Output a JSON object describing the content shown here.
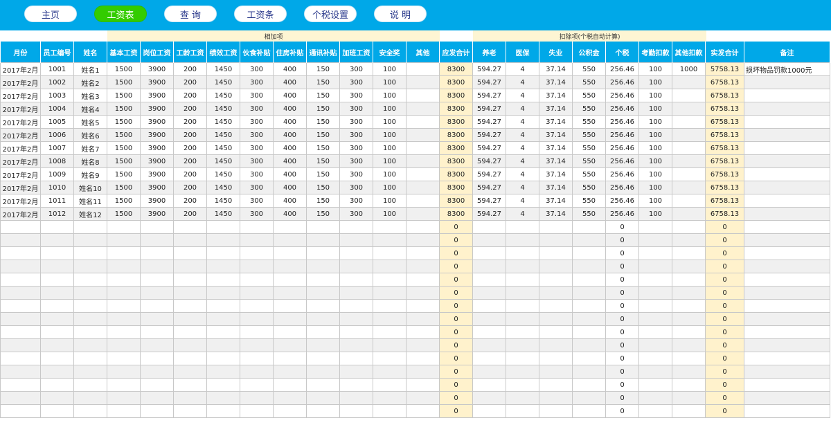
{
  "nav": [
    "主页",
    "工资表",
    "查 询",
    "工资条",
    "个税设置",
    "说 明"
  ],
  "groups": {
    "add": "相加项",
    "deduct": "扣除项(个税自动计算)"
  },
  "columns": [
    "月份",
    "员工编号",
    "姓名",
    "基本工资",
    "岗位工资",
    "工龄工资",
    "绩效工资",
    "伙食补贴",
    "住房补贴",
    "通讯补贴",
    "加班工资",
    "安全奖",
    "其他",
    "应发合计",
    "养老",
    "医保",
    "失业",
    "公积金",
    "个税",
    "考勤扣款",
    "其他扣款",
    "实发合计",
    "备注"
  ],
  "rows": [
    [
      "2017年2月",
      "1001",
      "姓名1",
      "1500",
      "3900",
      "200",
      "1450",
      "300",
      "400",
      "150",
      "300",
      "100",
      "",
      "8300",
      "594.27",
      "4",
      "37.14",
      "550",
      "256.46",
      "100",
      "1000",
      "5758.13",
      "损坏物品罚款1000元"
    ],
    [
      "2017年2月",
      "1002",
      "姓名2",
      "1500",
      "3900",
      "200",
      "1450",
      "300",
      "400",
      "150",
      "300",
      "100",
      "",
      "8300",
      "594.27",
      "4",
      "37.14",
      "550",
      "256.46",
      "100",
      "",
      "6758.13",
      ""
    ],
    [
      "2017年2月",
      "1003",
      "姓名3",
      "1500",
      "3900",
      "200",
      "1450",
      "300",
      "400",
      "150",
      "300",
      "100",
      "",
      "8300",
      "594.27",
      "4",
      "37.14",
      "550",
      "256.46",
      "100",
      "",
      "6758.13",
      ""
    ],
    [
      "2017年2月",
      "1004",
      "姓名4",
      "1500",
      "3900",
      "200",
      "1450",
      "300",
      "400",
      "150",
      "300",
      "100",
      "",
      "8300",
      "594.27",
      "4",
      "37.14",
      "550",
      "256.46",
      "100",
      "",
      "6758.13",
      ""
    ],
    [
      "2017年2月",
      "1005",
      "姓名5",
      "1500",
      "3900",
      "200",
      "1450",
      "300",
      "400",
      "150",
      "300",
      "100",
      "",
      "8300",
      "594.27",
      "4",
      "37.14",
      "550",
      "256.46",
      "100",
      "",
      "6758.13",
      ""
    ],
    [
      "2017年2月",
      "1006",
      "姓名6",
      "1500",
      "3900",
      "200",
      "1450",
      "300",
      "400",
      "150",
      "300",
      "100",
      "",
      "8300",
      "594.27",
      "4",
      "37.14",
      "550",
      "256.46",
      "100",
      "",
      "6758.13",
      ""
    ],
    [
      "2017年2月",
      "1007",
      "姓名7",
      "1500",
      "3900",
      "200",
      "1450",
      "300",
      "400",
      "150",
      "300",
      "100",
      "",
      "8300",
      "594.27",
      "4",
      "37.14",
      "550",
      "256.46",
      "100",
      "",
      "6758.13",
      ""
    ],
    [
      "2017年2月",
      "1008",
      "姓名8",
      "1500",
      "3900",
      "200",
      "1450",
      "300",
      "400",
      "150",
      "300",
      "100",
      "",
      "8300",
      "594.27",
      "4",
      "37.14",
      "550",
      "256.46",
      "100",
      "",
      "6758.13",
      ""
    ],
    [
      "2017年2月",
      "1009",
      "姓名9",
      "1500",
      "3900",
      "200",
      "1450",
      "300",
      "400",
      "150",
      "300",
      "100",
      "",
      "8300",
      "594.27",
      "4",
      "37.14",
      "550",
      "256.46",
      "100",
      "",
      "6758.13",
      ""
    ],
    [
      "2017年2月",
      "1010",
      "姓名10",
      "1500",
      "3900",
      "200",
      "1450",
      "300",
      "400",
      "150",
      "300",
      "100",
      "",
      "8300",
      "594.27",
      "4",
      "37.14",
      "550",
      "256.46",
      "100",
      "",
      "6758.13",
      ""
    ],
    [
      "2017年2月",
      "1011",
      "姓名11",
      "1500",
      "3900",
      "200",
      "1450",
      "300",
      "400",
      "150",
      "300",
      "100",
      "",
      "8300",
      "594.27",
      "4",
      "37.14",
      "550",
      "256.46",
      "100",
      "",
      "6758.13",
      ""
    ],
    [
      "2017年2月",
      "1012",
      "姓名12",
      "1500",
      "3900",
      "200",
      "1450",
      "300",
      "400",
      "150",
      "300",
      "100",
      "",
      "8300",
      "594.27",
      "4",
      "37.14",
      "550",
      "256.46",
      "100",
      "",
      "6758.13",
      ""
    ],
    [
      "",
      "",
      "",
      "",
      "",
      "",
      "",
      "",
      "",
      "",
      "",
      "",
      "",
      "0",
      "",
      "",
      "",
      "",
      "0",
      "",
      "",
      "0",
      ""
    ],
    [
      "",
      "",
      "",
      "",
      "",
      "",
      "",
      "",
      "",
      "",
      "",
      "",
      "",
      "0",
      "",
      "",
      "",
      "",
      "0",
      "",
      "",
      "0",
      ""
    ],
    [
      "",
      "",
      "",
      "",
      "",
      "",
      "",
      "",
      "",
      "",
      "",
      "",
      "",
      "0",
      "",
      "",
      "",
      "",
      "0",
      "",
      "",
      "0",
      ""
    ],
    [
      "",
      "",
      "",
      "",
      "",
      "",
      "",
      "",
      "",
      "",
      "",
      "",
      "",
      "0",
      "",
      "",
      "",
      "",
      "0",
      "",
      "",
      "0",
      ""
    ],
    [
      "",
      "",
      "",
      "",
      "",
      "",
      "",
      "",
      "",
      "",
      "",
      "",
      "",
      "0",
      "",
      "",
      "",
      "",
      "0",
      "",
      "",
      "0",
      ""
    ],
    [
      "",
      "",
      "",
      "",
      "",
      "",
      "",
      "",
      "",
      "",
      "",
      "",
      "",
      "0",
      "",
      "",
      "",
      "",
      "0",
      "",
      "",
      "0",
      ""
    ],
    [
      "",
      "",
      "",
      "",
      "",
      "",
      "",
      "",
      "",
      "",
      "",
      "",
      "",
      "0",
      "",
      "",
      "",
      "",
      "0",
      "",
      "",
      "0",
      ""
    ],
    [
      "",
      "",
      "",
      "",
      "",
      "",
      "",
      "",
      "",
      "",
      "",
      "",
      "",
      "0",
      "",
      "",
      "",
      "",
      "0",
      "",
      "",
      "0",
      ""
    ],
    [
      "",
      "",
      "",
      "",
      "",
      "",
      "",
      "",
      "",
      "",
      "",
      "",
      "",
      "0",
      "",
      "",
      "",
      "",
      "0",
      "",
      "",
      "0",
      ""
    ],
    [
      "",
      "",
      "",
      "",
      "",
      "",
      "",
      "",
      "",
      "",
      "",
      "",
      "",
      "0",
      "",
      "",
      "",
      "",
      "0",
      "",
      "",
      "0",
      ""
    ],
    [
      "",
      "",
      "",
      "",
      "",
      "",
      "",
      "",
      "",
      "",
      "",
      "",
      "",
      "0",
      "",
      "",
      "",
      "",
      "0",
      "",
      "",
      "0",
      ""
    ],
    [
      "",
      "",
      "",
      "",
      "",
      "",
      "",
      "",
      "",
      "",
      "",
      "",
      "",
      "0",
      "",
      "",
      "",
      "",
      "0",
      "",
      "",
      "0",
      ""
    ],
    [
      "",
      "",
      "",
      "",
      "",
      "",
      "",
      "",
      "",
      "",
      "",
      "",
      "",
      "0",
      "",
      "",
      "",
      "",
      "0",
      "",
      "",
      "0",
      ""
    ],
    [
      "",
      "",
      "",
      "",
      "",
      "",
      "",
      "",
      "",
      "",
      "",
      "",
      "",
      "0",
      "",
      "",
      "",
      "",
      "0",
      "",
      "",
      "0",
      ""
    ],
    [
      "",
      "",
      "",
      "",
      "",
      "",
      "",
      "",
      "",
      "",
      "",
      "",
      "",
      "0",
      "",
      "",
      "",
      "",
      "0",
      "",
      "",
      "0",
      ""
    ]
  ],
  "colors": {
    "header_bg": "#00a8e8",
    "active_nav": "#33cc00",
    "highlight": "#fff2cc",
    "stripe": "#f0f0f0"
  }
}
